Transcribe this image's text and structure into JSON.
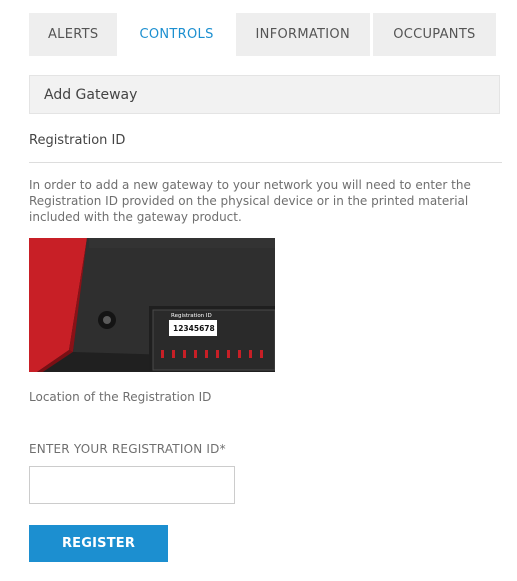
{
  "tabs": [
    {
      "label": "ALERTS",
      "active": false
    },
    {
      "label": "CONTROLS",
      "active": true
    },
    {
      "label": "INFORMATION",
      "active": false
    },
    {
      "label": "OCCUPANTS",
      "active": false
    }
  ],
  "section": {
    "title": "Add Gateway"
  },
  "registration": {
    "heading": "Registration ID",
    "instructions": "In order to add a new gateway to your network you will need to enter the Registration ID provided on the physical device or in the printed material included with the gateway product.",
    "image": {
      "label_title": "Registration ID",
      "label_value": "12345678"
    },
    "image_caption": "Location of the Registration ID",
    "field_label": "ENTER YOUR REGISTRATION ID*",
    "field_value": "",
    "field_placeholder": "",
    "submit_label": "REGISTER"
  },
  "colors": {
    "accent": "#1c8fd0",
    "tab_bg": "#eeeeee",
    "device_red": "#d0232a",
    "device_body": "#2b2b2b"
  }
}
